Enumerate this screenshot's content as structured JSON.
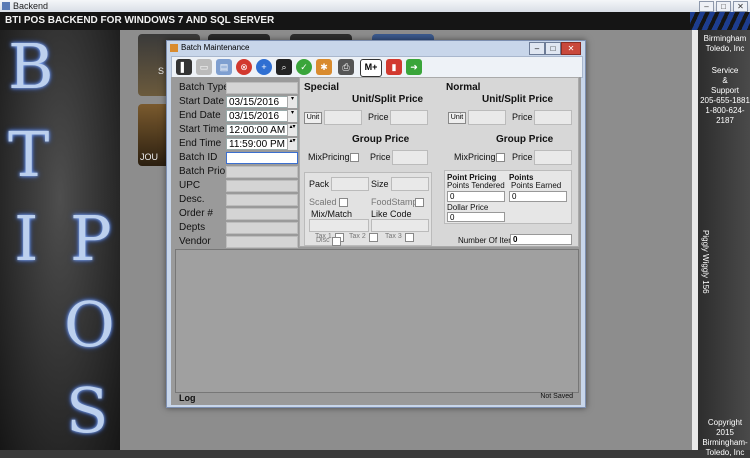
{
  "window": {
    "title": "Backend",
    "minimize": "–",
    "maximize": "□",
    "close": "✕"
  },
  "banner": {
    "text": "BTI POS BACKEND FOR WINDOWS 7 AND SQL SERVER"
  },
  "logo_letters": [
    "B",
    "T",
    "I",
    "P",
    "O",
    "S"
  ],
  "desktop_tiles": [
    {
      "label": "S"
    },
    {
      "label": ""
    },
    {
      "label": ""
    },
    {
      "label": ""
    },
    {
      "label": "JOU"
    }
  ],
  "right_panel": {
    "company": [
      "Birmingham",
      "Toledo, Inc"
    ],
    "service": [
      "Service",
      "&",
      "Support",
      "205-655-1881",
      "1-800-624-2187"
    ],
    "store": "Piggly Wiggly 156",
    "copyright": [
      "Copyright 2015",
      "Birmingham-",
      "Toledo, Inc"
    ]
  },
  "dialog": {
    "title": "Batch Maintenance",
    "toolbar_icons": [
      "new-icon",
      "list-icon",
      "save-icon",
      "delete-icon",
      "add-icon",
      "search-icon",
      "ok-icon",
      "tag-icon",
      "print-icon",
      "m-plus-icon",
      "remove-icon",
      "import-icon"
    ],
    "toolbar_text": {
      "m_plus": "M+"
    },
    "fields": {
      "batch_type": {
        "label": "Batch Type",
        "value": ""
      },
      "start_date": {
        "label": "Start Date",
        "value": "03/15/2016"
      },
      "end_date": {
        "label": "End Date",
        "value": "03/15/2016"
      },
      "start_time": {
        "label": "Start Time",
        "value": "12:00:00 AM"
      },
      "end_time": {
        "label": "End Time",
        "value": "11:59:00 PM"
      },
      "batch_id": {
        "label": "Batch ID",
        "value": ""
      },
      "batch_prio": {
        "label": "Batch Prio",
        "value": ""
      },
      "upc": {
        "label": "UPC",
        "value": ""
      },
      "desc": {
        "label": "Desc.",
        "value": ""
      },
      "order": {
        "label": "Order #",
        "value": ""
      },
      "depts": {
        "label": "Depts",
        "value": ""
      },
      "vendor": {
        "label": "Vendor",
        "value": ""
      }
    },
    "special": {
      "heading": "Special",
      "unit_split_price": "Unit/Split Price",
      "unit_button": "Unit",
      "price_label": "Price",
      "group_price": "Group Price",
      "mixpricing": "MixPricing",
      "pack": "Pack",
      "size": "Size",
      "scaled": "Scaled",
      "foodstamp": "FoodStamp",
      "mixmatch": "Mix/Match",
      "likecode": "Like Code",
      "tax1": "Tax 1",
      "tax2": "Tax 2",
      "tax3": "Tax 3",
      "disc": "Disc"
    },
    "normal": {
      "heading": "Normal",
      "unit_split_price": "Unit/Split Price",
      "unit_button": "Unit",
      "price_label": "Price",
      "group_price": "Group Price",
      "mixpricing": "MixPricing",
      "point_pricing": "Point Pricing",
      "points": "Points",
      "points_tendered": "Points Tendered",
      "points_earned": "Points Earned",
      "points_tendered_value": "0",
      "points_earned_value": "0",
      "dollar_price": "Dollar Price",
      "dollar_price_value": "0",
      "number_of_items": "Number Of Items",
      "number_of_items_value": "0"
    },
    "status": {
      "log": "Log",
      "saved": "Not Saved"
    }
  }
}
